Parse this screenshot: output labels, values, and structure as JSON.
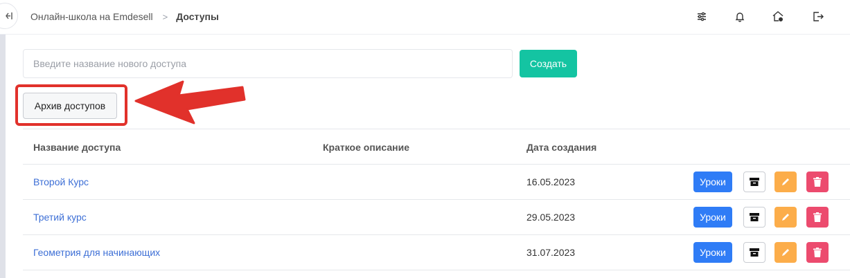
{
  "breadcrumb": {
    "school": "Онлайн-школа на Emdesell",
    "separator": ">",
    "current": "Доступы"
  },
  "topbar_icons": [
    "sliders-icon",
    "bell-icon",
    "home-settings-icon",
    "logout-icon"
  ],
  "new_access": {
    "placeholder": "Введите название нового доступа",
    "value": "",
    "create_label": "Создать"
  },
  "archive_button_label": "Архив доступов",
  "colors": {
    "create": "#14c4a2",
    "lessons": "#2f7cf6",
    "edit": "#fcad4a",
    "delete": "#ec4b6e",
    "link": "#3d6fd6",
    "highlight": "#e1312b"
  },
  "table": {
    "headers": {
      "name": "Название доступа",
      "description": "Краткое описание",
      "created": "Дата создания"
    },
    "rows": [
      {
        "name": "Второй Курс",
        "description": "",
        "created": "16.05.2023",
        "lessons_label": "Уроки"
      },
      {
        "name": "Третий курс",
        "description": "",
        "created": "29.05.2023",
        "lessons_label": "Уроки"
      },
      {
        "name": "Геометрия для начинающих",
        "description": "",
        "created": "31.07.2023",
        "lessons_label": "Уроки"
      }
    ]
  }
}
